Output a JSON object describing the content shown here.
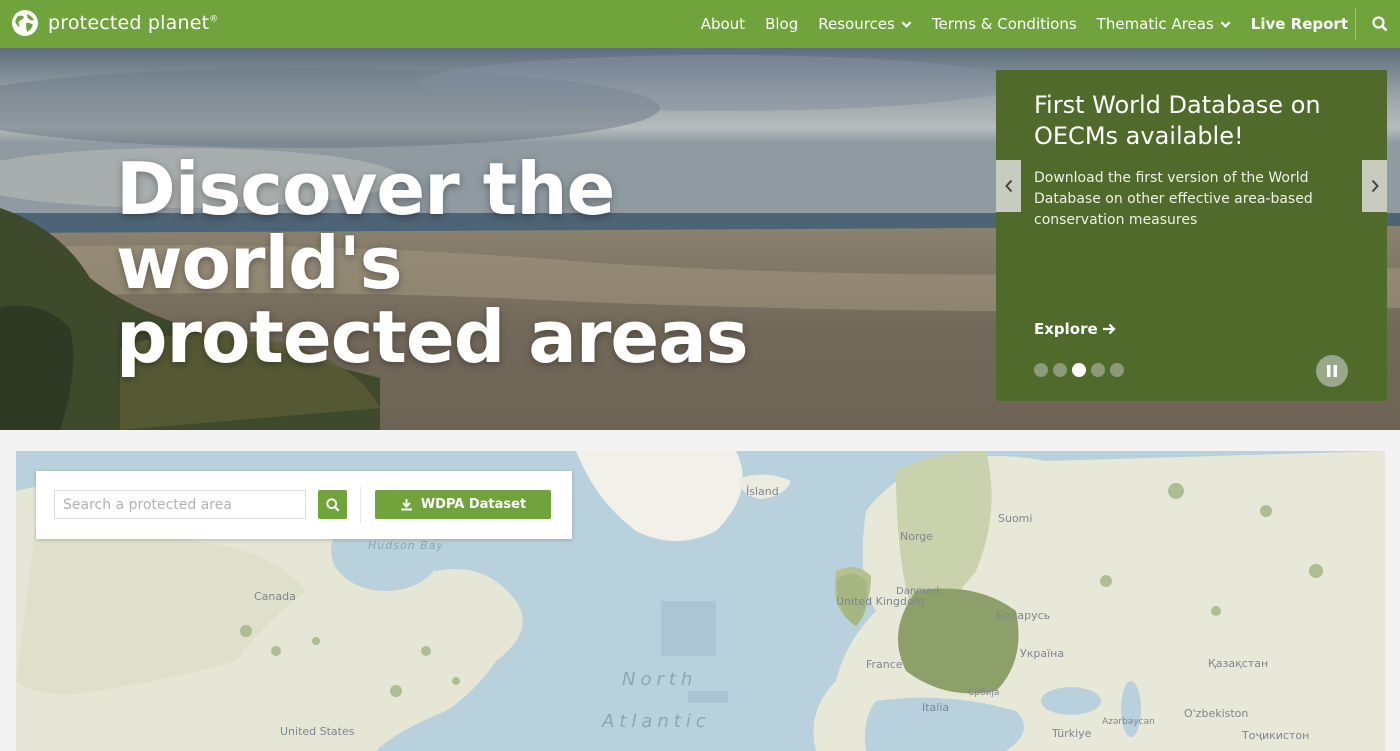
{
  "header": {
    "logo_text": "protected planet",
    "logo_mark": "®",
    "nav": [
      {
        "label": "About",
        "dropdown": false,
        "bold": false
      },
      {
        "label": "Blog",
        "dropdown": false,
        "bold": false
      },
      {
        "label": "Resources",
        "dropdown": true,
        "bold": false
      },
      {
        "label": "Terms & Conditions",
        "dropdown": false,
        "bold": false
      },
      {
        "label": "Thematic Areas",
        "dropdown": true,
        "bold": false
      },
      {
        "label": "Live Report",
        "dropdown": false,
        "bold": true
      }
    ],
    "search_icon": "search-icon"
  },
  "hero": {
    "title_line1": "Discover the world's",
    "title_line2": "protected areas"
  },
  "carousel": {
    "title": "First World Database on OECMs available!",
    "description": "Download the first version of the World Database on other effective area-based conservation measures",
    "explore_label": "Explore",
    "slide_count": 5,
    "active_slide": 3
  },
  "search": {
    "placeholder": "Search a protected area",
    "value": "",
    "download_label": "WDPA Dataset"
  },
  "map": {
    "labels": {
      "hudson_bay": "Hudson Bay",
      "canada": "Canada",
      "united_states": "United States",
      "north_atlantic_1": "North",
      "north_atlantic_2": "Atlantic",
      "island": "Ísland",
      "norge": "Norge",
      "suomi": "Suomi",
      "united_kingdom": "United Kingdom",
      "belarus": "Беларусь",
      "ukraine": "Україна",
      "kazakhstan": "Қазақстан",
      "uzbekistan": "O'zbekiston",
      "turkiye": "Türkiye",
      "azerbaycan": "Azərbaycan",
      "tojikiston": "Тоҷикистон",
      "france": "France",
      "srbija": "Србија",
      "italia": "Italia",
      "danmark": "Danmark"
    }
  },
  "colors": {
    "brand_green": "#71a33c",
    "card_green": "#4f6a2a"
  }
}
